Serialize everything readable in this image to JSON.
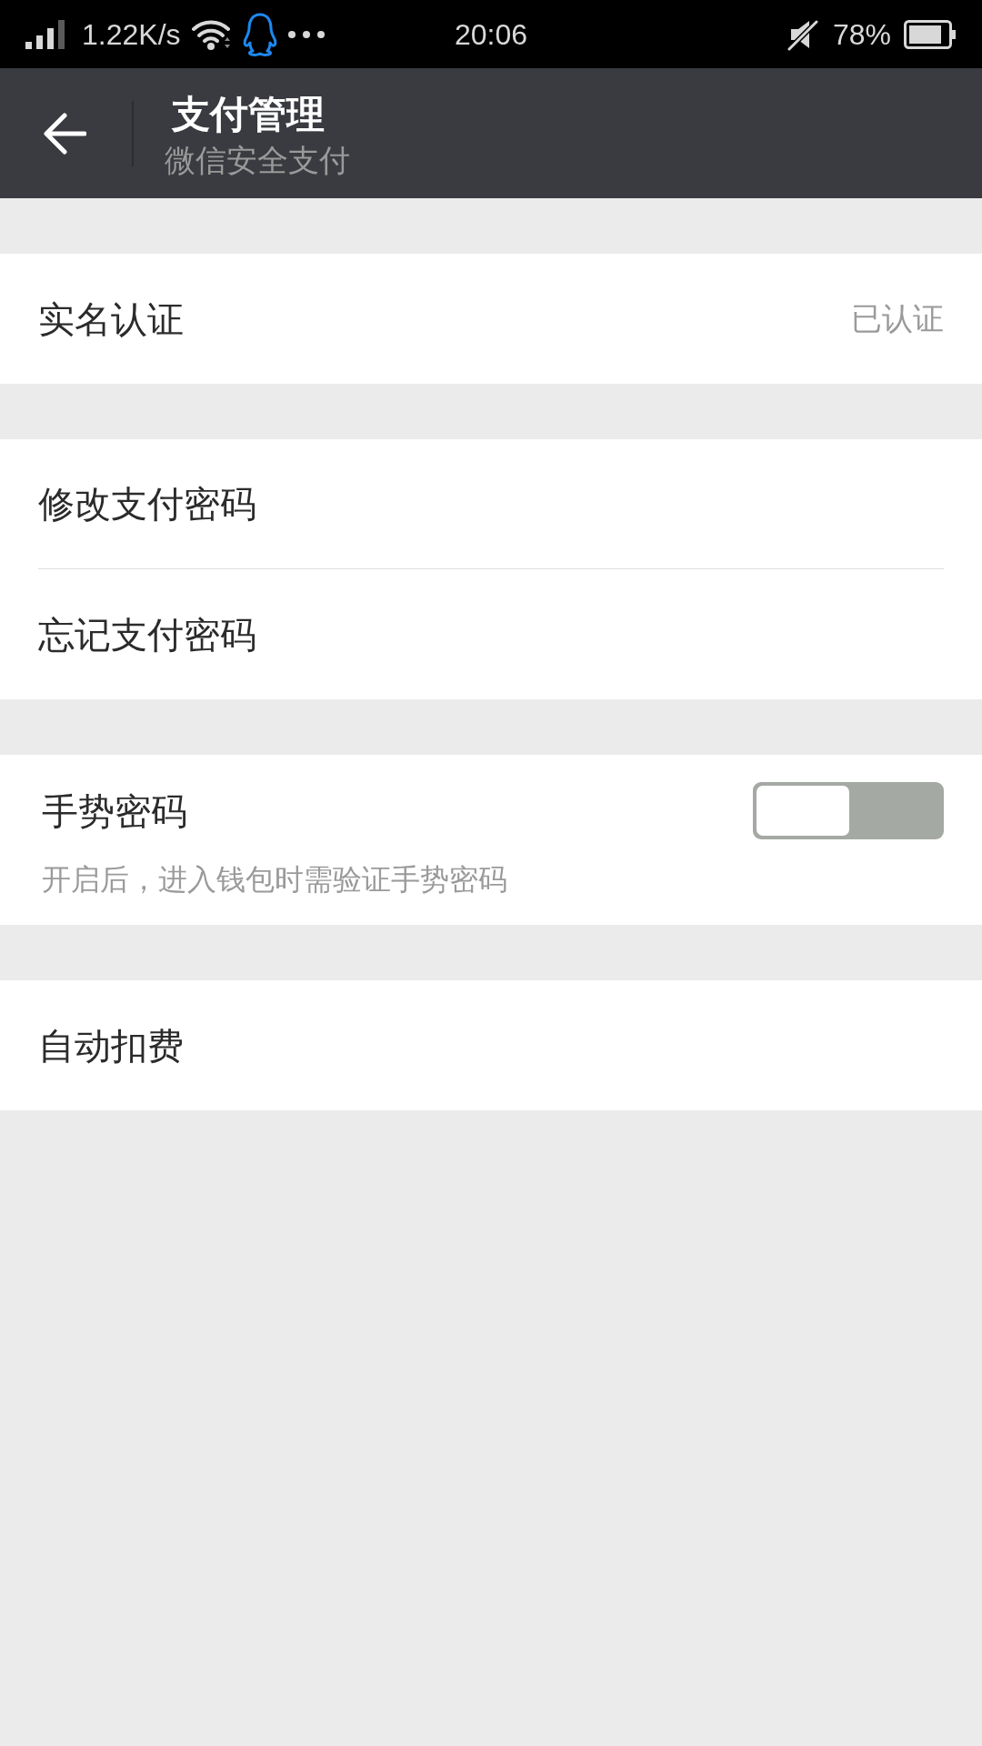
{
  "status_bar": {
    "network_speed": "1.22K/s",
    "time": "20:06",
    "battery": "78%"
  },
  "header": {
    "title": "支付管理",
    "subtitle": "微信安全支付"
  },
  "sections": [
    {
      "items": [
        {
          "kind": "link",
          "label": "实名认证",
          "value": "已认证"
        }
      ]
    },
    {
      "items": [
        {
          "kind": "link",
          "label": "修改支付密码"
        },
        {
          "kind": "link",
          "label": "忘记支付密码"
        }
      ]
    },
    {
      "items": [
        {
          "kind": "toggle",
          "label": "手势密码",
          "on": false,
          "description": "开启后，进入钱包时需验证手势密码"
        }
      ]
    },
    {
      "items": [
        {
          "kind": "link",
          "label": "自动扣费"
        }
      ]
    }
  ]
}
